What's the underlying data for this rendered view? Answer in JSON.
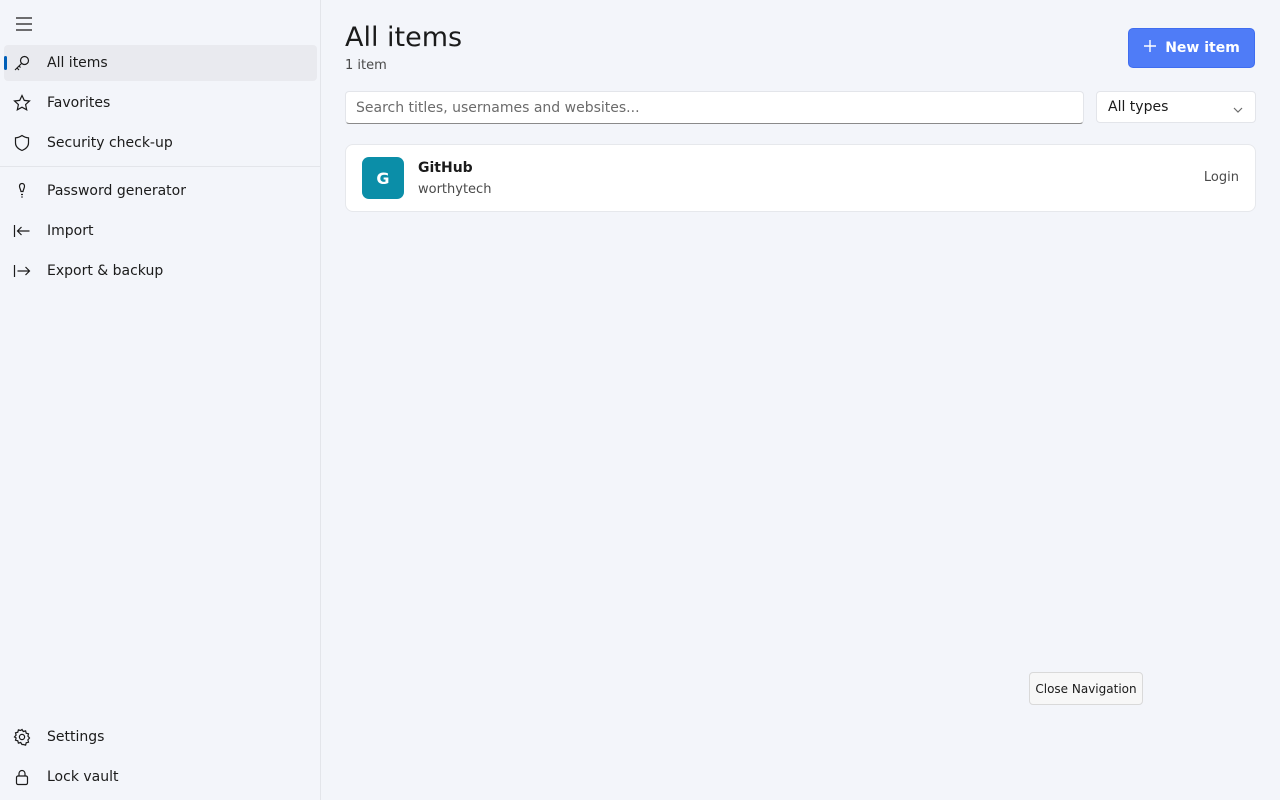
{
  "sidebar": {
    "menu_icon": "hamburger-icon",
    "items": [
      {
        "label": "All items",
        "icon": "key-icon",
        "active": true
      },
      {
        "label": "Favorites",
        "icon": "star-icon"
      },
      {
        "label": "Security check-up",
        "icon": "shield-icon"
      },
      {
        "label": "Password generator",
        "icon": "lightbulb-icon"
      },
      {
        "label": "Import",
        "icon": "import-arrow-icon"
      },
      {
        "label": "Export & backup",
        "icon": "export-arrow-icon"
      }
    ],
    "bottom_items": [
      {
        "label": "Settings",
        "icon": "gear-icon"
      },
      {
        "label": "Lock vault",
        "icon": "lock-icon"
      }
    ]
  },
  "main": {
    "title": "All items",
    "count": "1 item",
    "new_button_label": "New item",
    "search_placeholder": "Search titles, usernames and websites...",
    "type_filter": "All types",
    "items": [
      {
        "initial": "G",
        "title": "GitHub",
        "username": "worthytech",
        "type": "Login",
        "avatar_color": "#0b8ea8"
      }
    ]
  },
  "tooltip": "Close Navigation",
  "colors": {
    "accent": "#4f7cf7",
    "active_indicator": "#005fb8"
  }
}
